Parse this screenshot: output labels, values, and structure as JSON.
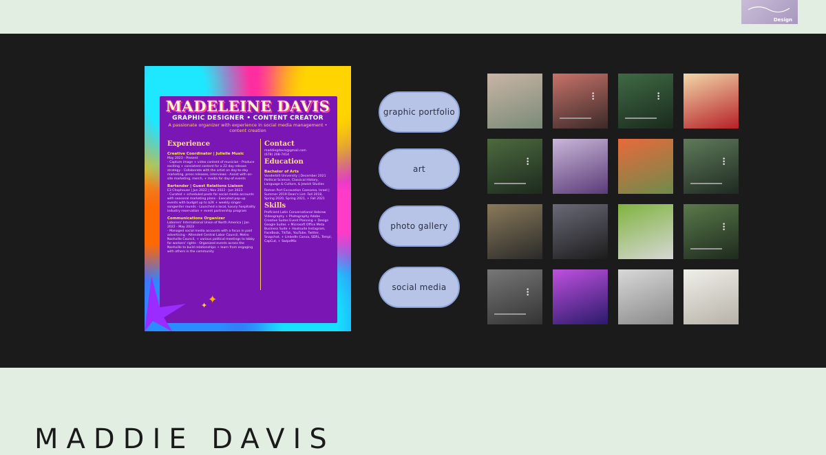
{
  "header": {
    "logo_text": "Design"
  },
  "resume": {
    "name": "MADELEINE DAVIS",
    "role": "GRAPHIC DESIGNER • CONTENT CREATOR",
    "tagline": "A passionate organizer with experience in social media management • content creation",
    "experience_heading": "Experience",
    "jobs": [
      {
        "title": "Creative Coordinator | Julielle Music",
        "dates": "May 2023 - Present",
        "notes": "- Capture image + video content of musician - Produce exciting + consistent content for a 22 day release strategy - Collaborate with the artist on day-to-day marketing, press releases, interviews - Assist with on-site marketing, merch, + media for day-of events"
      },
      {
        "title": "Bartender | Guest Relations Liaison",
        "dates": "E3 Chophouse | Jun 2022 | Nov 2022 - Jun 2023",
        "notes": "- Curated + scheduled posts for social media accounts with seasonal marketing plans - Executed pop-up events with budget up to $2K + weekly singer-songwriter rounds - Launched a local, luxury hospitality industry reservation + event partnership program"
      },
      {
        "title": "Communications Organizer",
        "dates": "Laborers' International Union of North America | Jan 2022 - May 2023",
        "notes": "- Managed social media accounts with a focus in paid advertising - Attended Central Labor Council, Metro Nashville Council, + various political meetings to lobby for workers' rights - Organized events across the Nashville to build relationships + learn from engaging with others in the community"
      }
    ],
    "contact_heading": "Contact",
    "contact_lines": [
      "maddiegdavis@gmail.com",
      "(678) 208-7414"
    ],
    "education_heading": "Education",
    "degree": "Bachelor of Arts",
    "education_lines": "Vanderbilt University | December 2021 Political Science, Classical History, Language & Culture, & Jewish Studies",
    "education_more": "Roman Port Excavation Caesarea, Israel | Summer 2019 Dean's List- Fall 2018, Spring 2020, Spring 2021, + Fall 2021",
    "skills_heading": "Skills",
    "skills_text": "Proficient Latin Conversational Hebrew Videography + Photography Adobe Creative Suites Event Planning + Design Google Suites + Microsoft Office Meta Business Suite + Hootsuite Instagram, FaceBook, TikTok, YouTube, Twitter, Snapchat, + LinkedIn Canva, SDRL, Templ, CapCut, + SwipeMix"
  },
  "nav": {
    "buttons": [
      {
        "label": "graphic portfolio"
      },
      {
        "label": "art"
      },
      {
        "label": "photo gallery"
      },
      {
        "label": "social media"
      }
    ]
  },
  "gallery": {
    "thumbs": [
      {
        "colors": [
          "#7a8a78",
          "#c9b5a6"
        ],
        "video": false
      },
      {
        "colors": [
          "#3a2a28",
          "#c8726a"
        ],
        "video": true
      },
      {
        "colors": [
          "#1a2a1e",
          "#3f6a44"
        ],
        "video": true
      },
      {
        "colors": [
          "#b52028",
          "#f2d8a8"
        ],
        "video": false
      },
      {
        "colors": [
          "#1d2a1e",
          "#4d6a3f"
        ],
        "video": true
      },
      {
        "colors": [
          "#5a3b78",
          "#c9b7d8"
        ],
        "video": false
      },
      {
        "colors": [
          "#6e8b4c",
          "#e86a3a"
        ],
        "video": false
      },
      {
        "colors": [
          "#1f2a22",
          "#5f7a5a"
        ],
        "video": true
      },
      {
        "colors": [
          "#2a2a2a",
          "#8a7a5a"
        ],
        "video": false
      },
      {
        "colors": [
          "#1c1c1c",
          "#6a6a78"
        ],
        "video": false
      },
      {
        "colors": [
          "#d7d7d4",
          "#7fb43f"
        ],
        "video": false
      },
      {
        "colors": [
          "#1e2a1e",
          "#5a7a4a"
        ],
        "video": true
      },
      {
        "colors": [
          "#333333",
          "#777777"
        ],
        "video": true
      },
      {
        "colors": [
          "#2a1a6a",
          "#c050e0"
        ],
        "video": false
      },
      {
        "colors": [
          "#8a8a8a",
          "#d8d8d8"
        ],
        "video": false
      },
      {
        "colors": [
          "#b7b2a8",
          "#efefe9"
        ],
        "video": false
      }
    ]
  },
  "footer": {
    "title": "MADDIE DAVIS"
  }
}
